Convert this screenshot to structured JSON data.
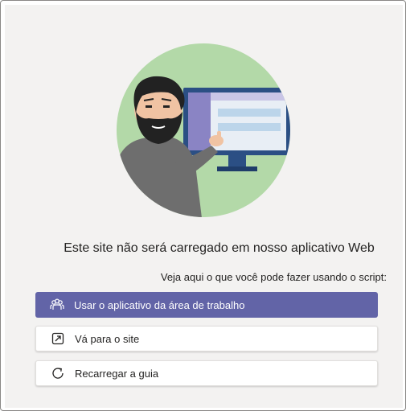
{
  "message": {
    "headline": "Este site não será carregado em nosso aplicativo Web",
    "subline": "Veja aqui o que você pode fazer usando o script:"
  },
  "actions": [
    {
      "label": "Usar o aplicativo da área de trabalho",
      "icon": "teams-desktop-icon"
    },
    {
      "label": "Vá para o site",
      "icon": "open-external-icon"
    },
    {
      "label": "Recarregar a guia",
      "icon": "refresh-icon"
    }
  ],
  "colors": {
    "accent": "#6264a7",
    "panel_bg": "#f3f2f1",
    "illustration_circle": "#b3d9a8",
    "monitor_frame": "#2b4f84"
  }
}
